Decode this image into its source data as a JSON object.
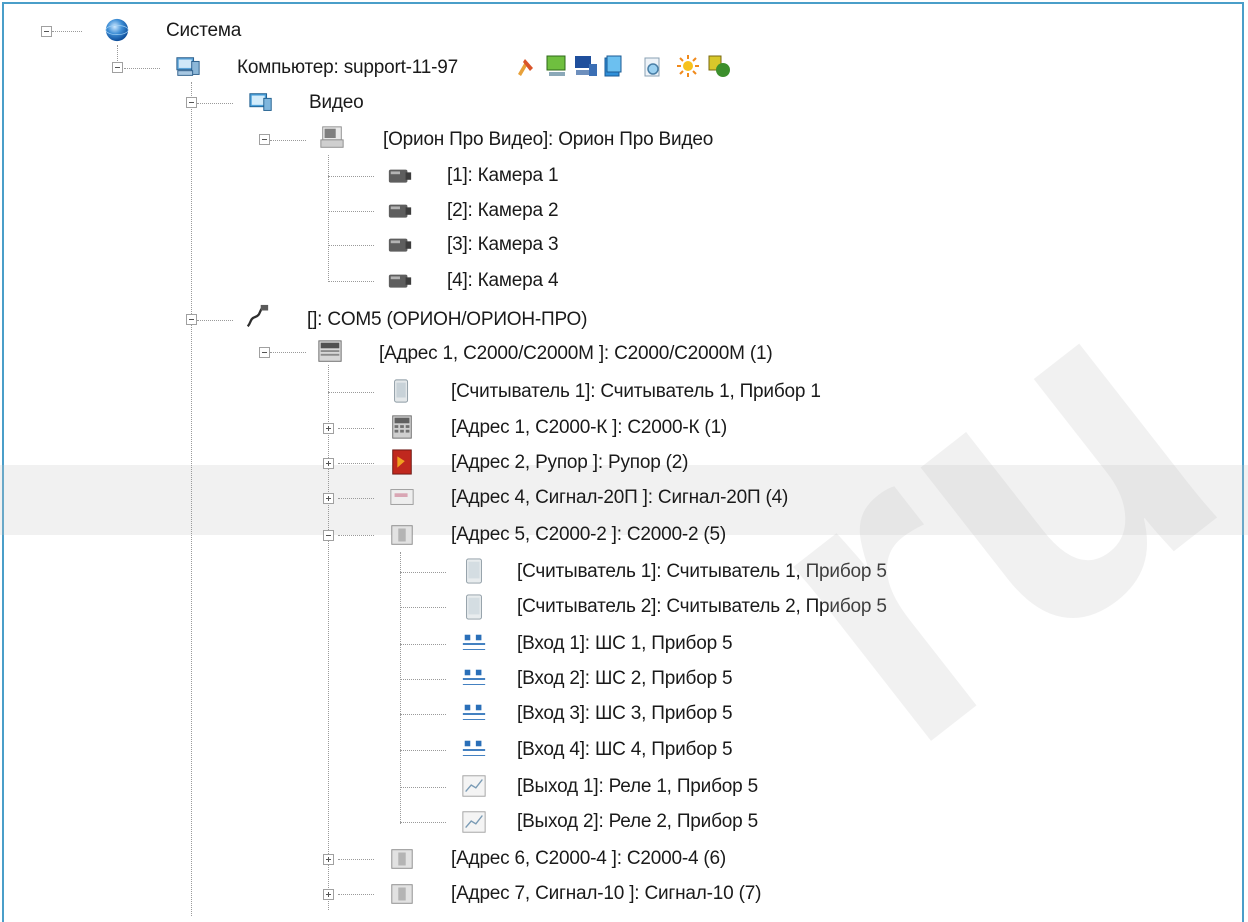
{
  "tree": {
    "root": {
      "label": "Система",
      "icon": "globe-icon"
    },
    "computer": {
      "label": "Компьютер: support-11-97",
      "toolbar_icons": [
        "tools-icon",
        "monitor-icon",
        "computer-icon",
        "database-icon",
        "document-search-icon",
        "sun-icon",
        "refresh-icon"
      ]
    },
    "video": {
      "label": "Видео",
      "server": {
        "label": "[Орион Про Видео]: Орион Про Видео"
      },
      "cameras": [
        {
          "label": "[1]: Камера 1"
        },
        {
          "label": "[2]: Камера 2"
        },
        {
          "label": "[3]: Камера 3"
        },
        {
          "label": "[4]: Камера 4"
        }
      ]
    },
    "com": {
      "label": "[]: COM5 (ОРИОН/ОРИОН-ПРО)",
      "controller": {
        "label": "[Адрес 1, С2000/С2000М ]: С2000/С2000М (1)",
        "children": [
          {
            "label": "[Считыватель 1]: Считыватель 1, Прибор 1",
            "icon": "reader-icon"
          },
          {
            "label": "[Адрес 1, С2000-К ]: С2000-К (1)",
            "icon": "keypad-icon"
          },
          {
            "label": "[Адрес 2, Рупор ]: Рупор (2)",
            "icon": "speaker-device-icon"
          },
          {
            "label": "[Адрес 4, Сигнал-20П ]: Сигнал-20П (4)",
            "icon": "signal-device-icon"
          },
          {
            "label": "[Адрес 5, С2000-2 ]: С2000-2 (5)",
            "icon": "controller-device-icon"
          }
        ],
        "device5_children": [
          {
            "label": "[Считыватель 1]: Считыватель 1, Прибор 5",
            "icon": "reader-icon"
          },
          {
            "label": "[Считыватель 2]: Считыватель 2, Прибор 5",
            "icon": "reader-icon"
          },
          {
            "label": "[Вход 1]: ШС 1, Прибор 5",
            "icon": "loop-input-icon"
          },
          {
            "label": "[Вход 2]: ШС 2, Прибор 5",
            "icon": "loop-input-icon"
          },
          {
            "label": "[Вход 3]: ШС 3, Прибор 5",
            "icon": "loop-input-icon"
          },
          {
            "label": "[Вход 4]: ШС 4, Прибор 5",
            "icon": "loop-input-icon"
          },
          {
            "label": "[Выход 1]: Реле 1, Прибор 5",
            "icon": "relay-icon"
          },
          {
            "label": "[Выход 2]: Реле 2, Прибор 5",
            "icon": "relay-icon"
          }
        ],
        "tail": [
          {
            "label": "[Адрес 6, С2000-4 ]: С2000-4 (6)",
            "icon": "controller-device-icon"
          },
          {
            "label": "[Адрес 7, Сигнал-10 ]: Сигнал-10 (7)",
            "icon": "controller-device-icon"
          }
        ]
      }
    }
  },
  "watermark": {
    "text": "ru"
  }
}
